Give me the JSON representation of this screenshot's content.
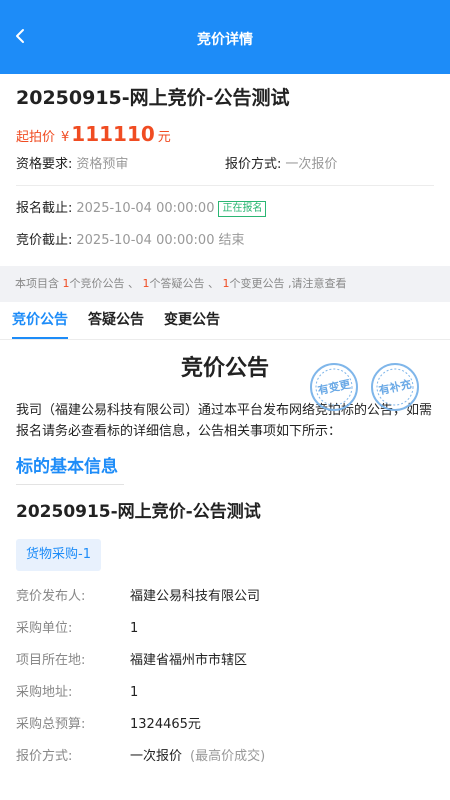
{
  "nav": {
    "title": "竞价详情"
  },
  "header": {
    "title": "20250915-网上竞价-公告测试",
    "price_label": "起拍价",
    "currency": "¥",
    "price": "111110",
    "price_unit": "元",
    "qualification_label": "资格要求:",
    "qualification_value": "资格预审",
    "quote_label": "报价方式:",
    "quote_value": "一次报价",
    "signup_deadline_label": "报名截止:",
    "signup_deadline_value": "2025-10-04 00:00:00",
    "signup_status": "正在报名",
    "bid_deadline_label": "竞价截止:",
    "bid_deadline_value": "2025-10-04 00:00:00",
    "bid_status": "结束"
  },
  "notice_bar": {
    "prefix": "本项目含",
    "count1": "1",
    "text1": "个竞价公告 、",
    "count2": "1",
    "text2": "个答疑公告 、",
    "count3": "1",
    "text3": "个变更公告 ,请注意查看"
  },
  "tabs": [
    {
      "label": "竞价公告"
    },
    {
      "label": "答疑公告"
    },
    {
      "label": "变更公告"
    }
  ],
  "document": {
    "title": "竞价公告",
    "stamp_changed": "有变更",
    "stamp_supplement": "有补充",
    "intro": "我司（福建公易科技有限公司）通过本平台发布网络竞拍标的公告，如需报名请务必查看标的详细信息，公告相关事项如下所示：",
    "section_title": "标的基本信息",
    "project_title": "20250915-网上竞价-公告测试",
    "category_tag": "货物采购-1",
    "info": [
      {
        "key": "竞价发布人:",
        "value": "福建公易科技有限公司"
      },
      {
        "key": "采购单位:",
        "value": "1"
      },
      {
        "key": "项目所在地:",
        "value": "福建省福州市市辖区"
      },
      {
        "key": "采购地址:",
        "value": "1"
      },
      {
        "key": "采购总预算:",
        "value": "1324465元"
      },
      {
        "key": "报价方式:",
        "value": "一次报价",
        "sub": "(最高价成交)"
      }
    ]
  },
  "colors": {
    "primary": "#1d8cf8",
    "price": "#f04c22",
    "status_green": "#2bb673",
    "stamp": "#7fb6ea"
  }
}
